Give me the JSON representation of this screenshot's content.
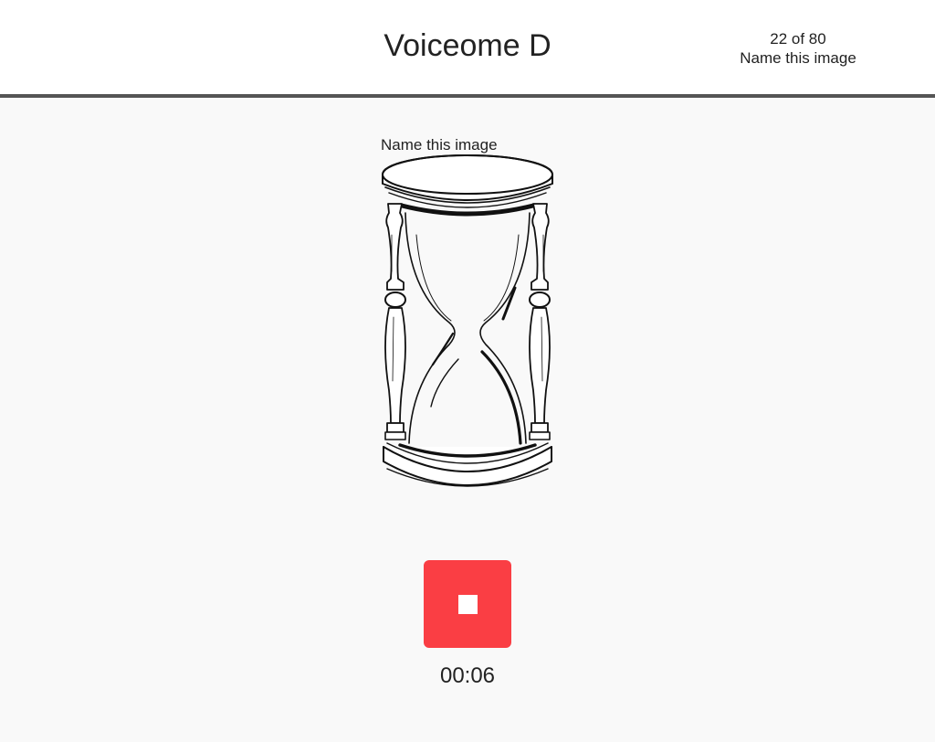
{
  "header": {
    "title": "Voiceome D",
    "progress": {
      "count": "22 of 80",
      "task": "Name this image"
    }
  },
  "main": {
    "prompt": "Name this image",
    "image": {
      "icon": "hourglass-icon"
    },
    "record": {
      "stop_icon": "stop-icon",
      "button_color": "#fa3e44",
      "elapsed": "00:06"
    }
  }
}
